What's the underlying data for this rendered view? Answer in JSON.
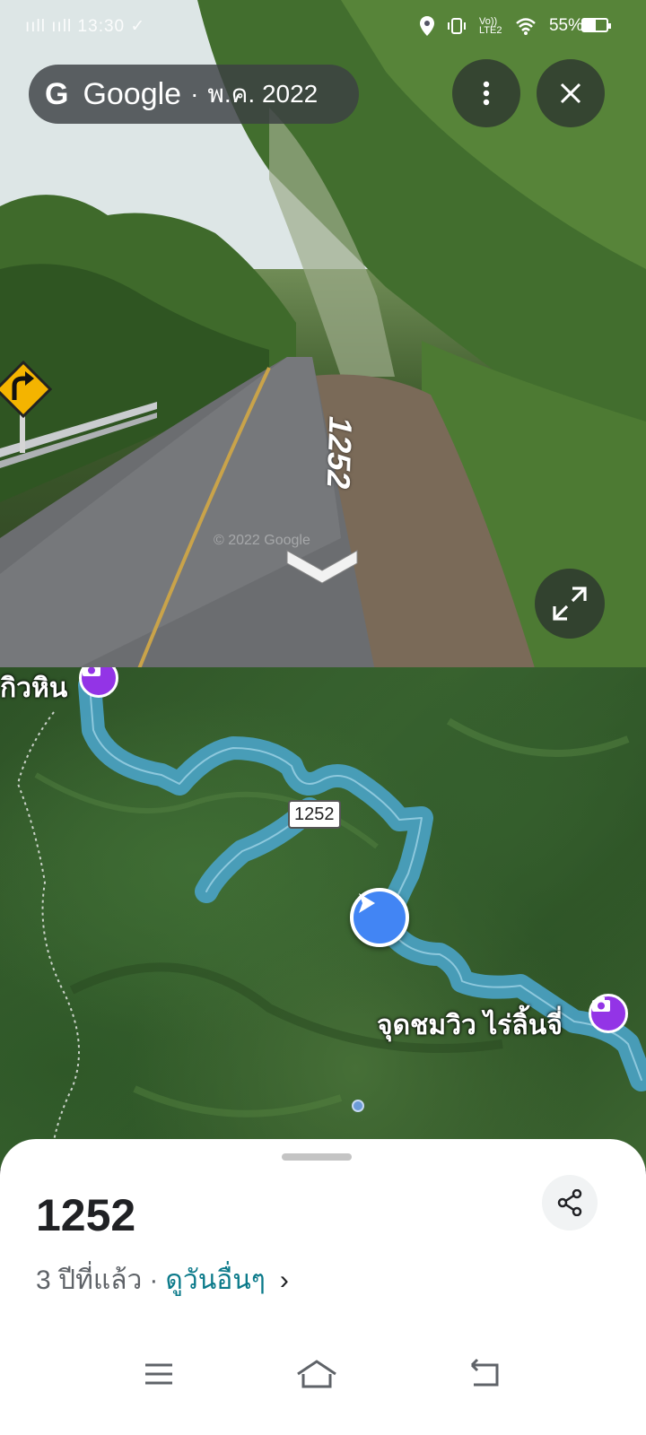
{
  "status_bar": {
    "left_text": "ııll ııll 13:30 ✓",
    "battery_text": "55%",
    "battery_level": 0.55,
    "network_label": "Vo)) LTE2"
  },
  "street_view": {
    "brand": "Google",
    "separator": "·",
    "capture_date": "พ.ค. 2022",
    "road_label": "1252",
    "watermark": "© 2022 Google",
    "icons": {
      "g_logo": "google-g-logo",
      "menu": "more-vert-icon",
      "close": "close-icon",
      "expand": "expand-icon",
      "move": "chevron-down-icon"
    }
  },
  "map": {
    "label_top": "กิวหิน",
    "label_viewpoint": "จุดชมวิว ไร่ลิ้นจี่",
    "route_shield": "1252",
    "colors": {
      "route": "#4aa3c6",
      "pegman": "#4285f4",
      "poi": "#9334e6"
    }
  },
  "sheet": {
    "title": "1252",
    "age": "3 ปีที่แล้ว",
    "separator": "·",
    "more_link": "ดูวันอื่นๆ",
    "chevron": "›"
  }
}
